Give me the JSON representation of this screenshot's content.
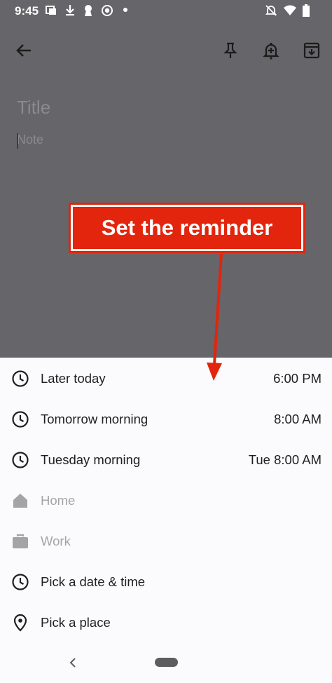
{
  "status_bar": {
    "time": "9:45"
  },
  "editor": {
    "title_placeholder": "Title",
    "note_placeholder": "Note"
  },
  "annotation": {
    "callout_text": "Set the reminder"
  },
  "reminder_options": [
    {
      "label": "Later today",
      "time": "6:00 PM",
      "icon": "clock-icon",
      "enabled": true
    },
    {
      "label": "Tomorrow morning",
      "time": "8:00 AM",
      "icon": "clock-icon",
      "enabled": true
    },
    {
      "label": "Tuesday morning",
      "time": "Tue 8:00 AM",
      "icon": "clock-icon",
      "enabled": true
    },
    {
      "label": "Home",
      "time": "",
      "icon": "home-icon",
      "enabled": false
    },
    {
      "label": "Work",
      "time": "",
      "icon": "briefcase-icon",
      "enabled": false
    },
    {
      "label": "Pick a date & time",
      "time": "",
      "icon": "clock-icon",
      "enabled": true
    },
    {
      "label": "Pick a place",
      "time": "",
      "icon": "location-pin-icon",
      "enabled": true
    }
  ],
  "colors": {
    "scrim": "#666569",
    "sheet": "#fbfafd",
    "callout_red": "#e2250c",
    "disabled_text": "#a4a4a6"
  }
}
